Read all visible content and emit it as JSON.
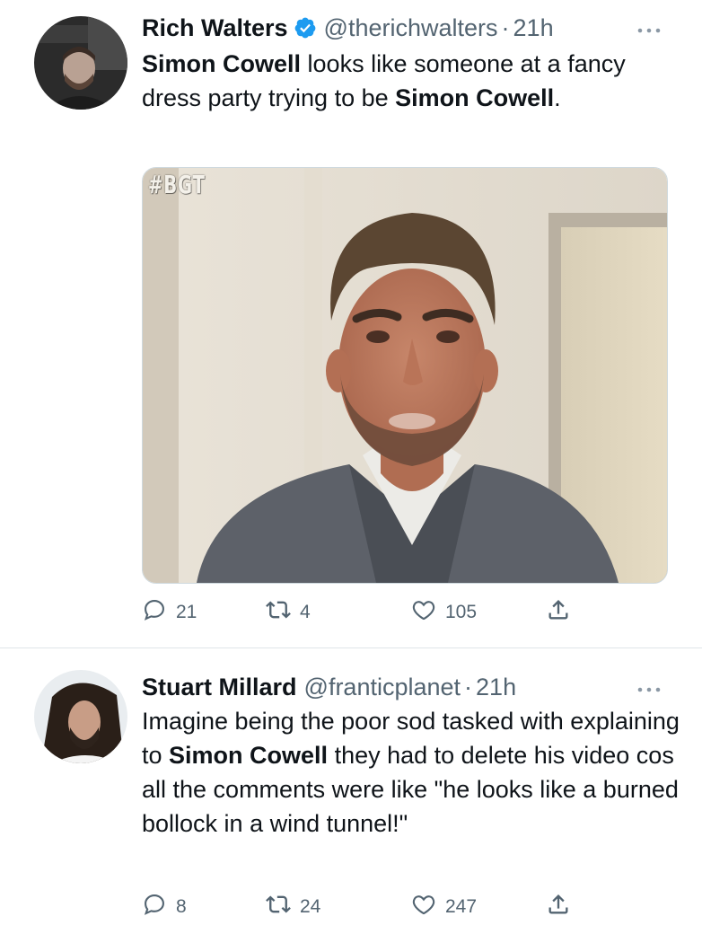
{
  "tweets": [
    {
      "author_name": "Rich Walters",
      "verified": true,
      "handle": "@therichwalters",
      "separator": "·",
      "time": "21h",
      "text_segments": [
        {
          "text": "Simon Cowell",
          "bold": true
        },
        {
          "text": " looks like someone at a fancy dress party trying to be ",
          "bold": false
        },
        {
          "text": "Simon Cowell",
          "bold": true
        },
        {
          "text": ".",
          "bold": false
        }
      ],
      "media": {
        "overlay_text": "#BGT"
      },
      "stats": {
        "replies": "21",
        "retweets": "4",
        "likes": "105"
      }
    },
    {
      "author_name": "Stuart Millard",
      "verified": false,
      "handle": "@franticplanet",
      "separator": "·",
      "time": "21h",
      "text_segments": [
        {
          "text": "Imagine being the poor sod tasked with explaining to ",
          "bold": false
        },
        {
          "text": "Simon Cowell",
          "bold": true
        },
        {
          "text": " they had to delete his video cos all the comments were like \"he looks like a burned bollock in a wind tunnel!\"",
          "bold": false
        }
      ],
      "stats": {
        "replies": "8",
        "retweets": "24",
        "likes": "247"
      }
    }
  ],
  "icons": {
    "verified": "verified-badge-icon",
    "more": "more-options-icon",
    "reply": "reply-icon",
    "retweet": "retweet-icon",
    "like": "heart-icon",
    "share": "share-icon"
  },
  "colors": {
    "text": "#0f1419",
    "secondary": "#536471",
    "verified": "#1d9bf0",
    "divider": "#dfe4e8"
  }
}
